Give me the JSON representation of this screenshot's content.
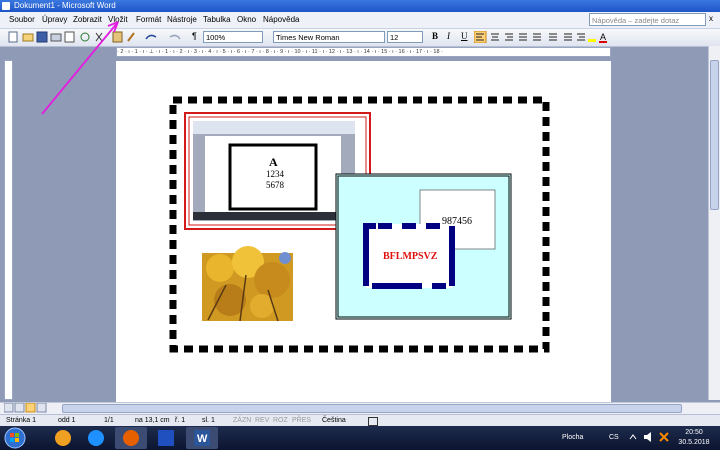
{
  "window": {
    "title": "Dokument1 - Microsoft Word"
  },
  "menu": [
    "Soubor",
    "Úpravy",
    "Zobrazit",
    "Vložit",
    "Formát",
    "Nástroje",
    "Tabulka",
    "Okno",
    "Nápověda"
  ],
  "help": {
    "placeholder": "Nápověda – zadejte dotaz",
    "close": "x"
  },
  "toolbar": {
    "zoom": "100%",
    "font": "Times New Roman",
    "size": "12",
    "bold": "B",
    "italic": "I",
    "underline": "U",
    "pilcrow": "¶"
  },
  "ruler": {
    "text": "· 2 · ı · 1 · ı · ⊥ · ı · 1 · ı · 2 · ı · 3 · ı · 4 · ı · 5 · ı · 6 · ı · 7 · ı · 8 · ı · 9 · ı · 10 · ı · 11 · ı · 12 · ı · 13 · ı · 14 · ı · 15 · ı · 16 · ı · 17 · ı · 18 ·"
  },
  "document": {
    "inner_shot": {
      "letter": "A",
      "line1": "1234",
      "line2": "5678"
    },
    "number_box": "987456",
    "red_text": "BFLMPSVZ"
  },
  "status": {
    "page": "Stránka 1",
    "section": "odd 1",
    "pages": "1/1",
    "at": "na 13,1 cm",
    "line": "ř. 1",
    "col": "sl. 1",
    "rec": "ZÁZN",
    "rev": "REV",
    "ext": "ROZ",
    "ovr": "PŘES",
    "lang": "Čeština"
  },
  "taskbar": {
    "desktop": "Plocha",
    "lang": "CS",
    "time": "20:50",
    "date": "30.5.2018"
  },
  "colors": {
    "annotation": "#e21ee0",
    "title_blue": "#2a63d6",
    "dash_black": "#000000",
    "cyan_fill": "#ccffff",
    "navy": "#000080",
    "red_text": "#e01010"
  }
}
